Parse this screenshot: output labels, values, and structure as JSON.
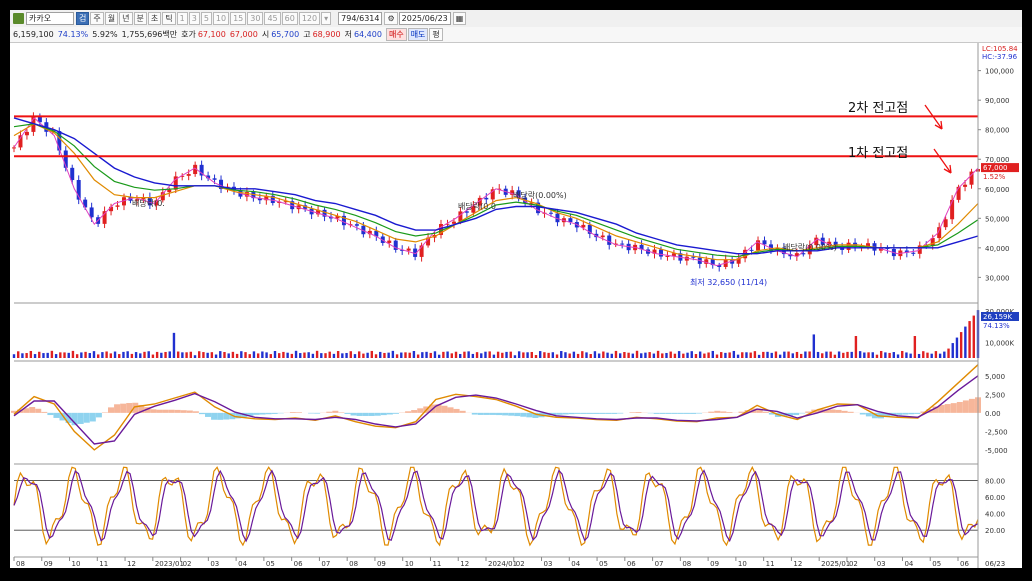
{
  "toolbar": {
    "stock_name": "카카오",
    "btn_search": "검",
    "periods": [
      "주",
      "월",
      "년",
      "분",
      "초",
      "틱"
    ],
    "minutes": [
      "1",
      "3",
      "5",
      "10",
      "15",
      "30",
      "45",
      "60",
      "120"
    ],
    "count": "794/6314",
    "date": "2025/06/23"
  },
  "quote": {
    "volume": "6,159,100",
    "vol_ratio": "74.13%",
    "change_rate": "5.92%",
    "amount": "1,755,696백만",
    "hoga_label": "호가",
    "ask": "67,100",
    "bid": "67,000",
    "open_label": "시",
    "open": "65,700",
    "high_label": "고",
    "high": "68,900",
    "low_label": "저",
    "low": "64,400",
    "buy_label": "매수",
    "sell_label": "매도",
    "avg_label": "평"
  },
  "annotations": {
    "second_high": "2차 전고점",
    "first_high": "1차 전고점",
    "div1": "배당락(0.",
    "div2": "배당락(0.0",
    "div3": "배당락(0.00%)",
    "div4": "배당락(0.00%)",
    "low_mark": "최저 32,650 (11/14)"
  },
  "price_axis": {
    "lc": "LC:105.84",
    "hc": "HC:-37.96",
    "current": "67,000",
    "current_pct": "1.52%"
  },
  "volume_axis": {
    "current": "26,159K",
    "pct": "74.13%"
  },
  "colors": {
    "up": "#e02020",
    "down": "#2030d0",
    "ma_long": "#1a1ad0",
    "ma_mid": "#1a9a1a",
    "ma_short": "#e08a00",
    "resistance": "#ee1111"
  },
  "chart_data": [
    {
      "type": "line",
      "title": "",
      "xlabel": "",
      "ylabel": "",
      "ylim": [
        22000,
        108000
      ],
      "y_ticks": [
        "100,000",
        "90,000",
        "80,000",
        "70,000",
        "60,000",
        "50,000",
        "40,000",
        "30,000"
      ],
      "x_ticks": [
        "08",
        "09",
        "10",
        "11",
        "12",
        "2023/01",
        "02",
        "03",
        "04",
        "05",
        "06",
        "07",
        "08",
        "09",
        "10",
        "11",
        "12",
        "2024/01",
        "02",
        "03",
        "04",
        "05",
        "06",
        "07",
        "08",
        "09",
        "10",
        "11",
        "12",
        "2025/01",
        "02",
        "03",
        "04",
        "05",
        "06",
        "06/23"
      ],
      "horizontal_lines": [
        84500,
        71000
      ],
      "series": [
        {
          "values": [
            74000,
            84000,
            78000,
            60000,
            48000,
            55000,
            57000,
            55000,
            63000,
            67000,
            62000,
            59000,
            57000,
            56000,
            54000,
            52000,
            50000,
            47000,
            44000,
            40000,
            38000,
            46000,
            50000,
            55000,
            60000,
            58000,
            53000,
            50000,
            48000,
            44000,
            41000,
            40000,
            38000,
            37000,
            36000,
            34000,
            36000,
            42000,
            39000,
            37000,
            43000,
            40000,
            41000,
            40000,
            38000,
            39000,
            45000,
            60000,
            67000
          ]
        },
        {
          "values": [
            78000,
            82000,
            79000,
            72000,
            63000,
            58000,
            57000,
            57000,
            59000,
            61000,
            61000,
            59000,
            58000,
            57000,
            55000,
            53000,
            51000,
            49000,
            46000,
            43000,
            42000,
            44000,
            48000,
            52000,
            56000,
            57000,
            55000,
            52000,
            50000,
            47000,
            44000,
            42000,
            40000,
            38000,
            37000,
            36000,
            36000,
            39000,
            40000,
            39000,
            40000,
            41000,
            41000,
            40000,
            40000,
            40000,
            42000,
            48000,
            55000
          ]
        },
        {
          "values": [
            84000,
            82000,
            80000,
            77000,
            72000,
            67000,
            64000,
            62000,
            61000,
            61000,
            61000,
            60000,
            60000,
            59000,
            58000,
            56000,
            55000,
            53000,
            51000,
            48000,
            46000,
            46000,
            48000,
            50000,
            53000,
            54000,
            54000,
            53000,
            52000,
            50000,
            48000,
            45000,
            43000,
            41000,
            40000,
            39000,
            38000,
            38000,
            39000,
            39000,
            39000,
            40000,
            40000,
            40000,
            40000,
            40000,
            40000,
            42000,
            44000
          ]
        }
      ]
    },
    {
      "type": "bar",
      "title": "",
      "ylim": [
        0,
        35000
      ],
      "y_ticks": [
        "30,000K",
        "10,000K"
      ],
      "series": [
        {
          "name": "volume"
        }
      ]
    },
    {
      "type": "line",
      "title": "",
      "ylim": [
        -6500,
        7000
      ],
      "y_ticks": [
        "5,000",
        "2,500",
        "0.00",
        "-2,500",
        "-5,000"
      ],
      "series": [
        {
          "values": [
            -200,
            2200,
            1200,
            -2500,
            -5000,
            -3000,
            800,
            1200,
            2000,
            2800,
            800,
            -500,
            -800,
            -900,
            -700,
            -1000,
            -400,
            -1200,
            -1800,
            -2000,
            -1200,
            1800,
            2500,
            2200,
            1800,
            900,
            -200,
            -600,
            -700,
            -900,
            -1000,
            -600,
            -800,
            -1100,
            -1200,
            -700,
            -600,
            1000,
            -200,
            -900,
            400,
            1200,
            1100,
            -400,
            -600,
            -700,
            1500,
            4000,
            6500
          ]
        },
        {
          "values": [
            -400,
            1600,
            1600,
            -1300,
            -4200,
            -3800,
            -200,
            900,
            1700,
            2600,
            1500,
            100,
            -600,
            -800,
            -800,
            -900,
            -600,
            -900,
            -1500,
            -1900,
            -1500,
            900,
            2100,
            2400,
            2000,
            1200,
            300,
            -400,
            -600,
            -800,
            -900,
            -700,
            -700,
            -1000,
            -1100,
            -900,
            -600,
            500,
            200,
            -700,
            0,
            900,
            1100,
            200,
            -400,
            -600,
            800,
            3000,
            5000
          ]
        }
      ]
    },
    {
      "type": "line",
      "title": "",
      "ylim": [
        -10,
        100
      ],
      "y_ticks": [
        "80.00",
        "60.00",
        "40.00",
        "20.00"
      ],
      "guide_lines": [
        80,
        20
      ]
    }
  ]
}
